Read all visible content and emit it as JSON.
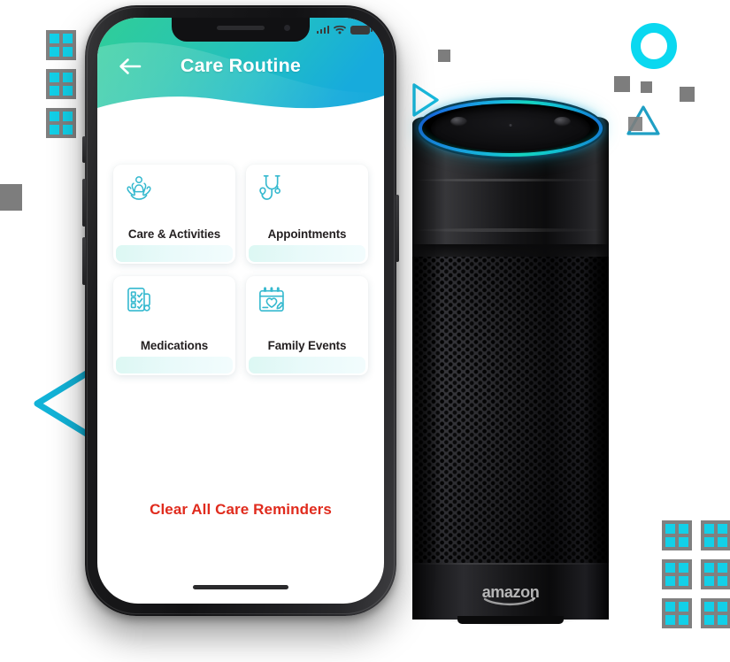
{
  "scene": {
    "description": "Marketing composition: smartphone app screen beside an Amazon Echo smart speaker",
    "background_color": "#ffffff",
    "accent_color": "#12d0e8",
    "grey_color": "#7d7d7d"
  },
  "phone": {
    "status_bar": {
      "signal_icon": "signal-bars-icon",
      "wifi_icon": "wifi-icon",
      "battery_icon": "battery-full-icon"
    },
    "header": {
      "title": "Care Routine",
      "back_icon": "arrow-left-icon",
      "gradient_from": "#2ecb9b",
      "gradient_to": "#1ab4d8"
    },
    "cards": [
      {
        "label": "Care & Activities",
        "icon": "hands-holding-person-icon"
      },
      {
        "label": "Appointments",
        "icon": "stethoscope-heart-icon"
      },
      {
        "label": "Medications",
        "icon": "checklist-clipboard-icon"
      },
      {
        "label": "Family Events",
        "icon": "calendar-heart-icon"
      }
    ],
    "clear_action": {
      "label": "Clear All Care Reminders",
      "color": "#e02b1d"
    },
    "home_indicator": "home-indicator-bar"
  },
  "echo": {
    "brand": "amazon",
    "light_ring_color": "#19b8e0",
    "top_buttons": [
      "mute-button",
      "action-button"
    ],
    "microphone": "microphone-pinhole"
  },
  "decorations": {
    "dot_grid_left": "dot-grid-pattern",
    "dot_grid_right": "dot-grid-pattern",
    "ring": "circle-outline-shape",
    "triangle_small": "triangle-outline-shape",
    "triangle_play": "play-triangle-outline-shape",
    "chevron_left": "chevron-left-shape",
    "squares": "square-shape"
  }
}
